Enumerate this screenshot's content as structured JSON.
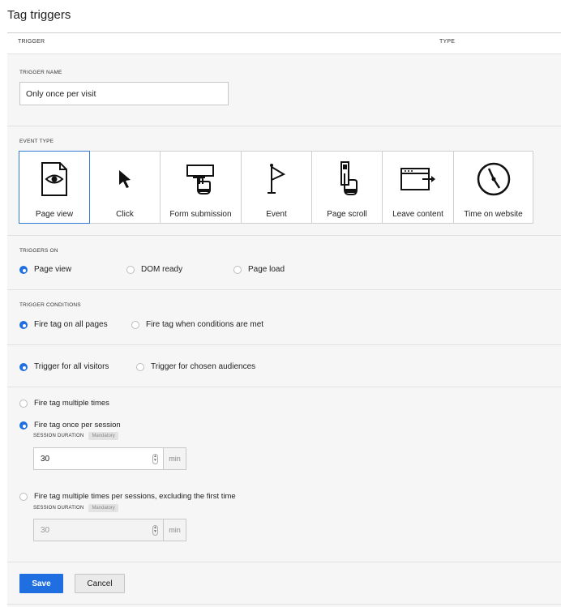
{
  "header": {
    "title": "Tag triggers",
    "col_trigger": "TRIGGER",
    "col_type": "TYPE"
  },
  "trigger_name": {
    "label": "TRIGGER NAME",
    "value": "Only once per visit"
  },
  "event_type": {
    "label": "EVENT TYPE",
    "selected": "Page view",
    "tiles": [
      {
        "label": "Page view",
        "icon": "page-view-icon"
      },
      {
        "label": "Click",
        "icon": "cursor-icon"
      },
      {
        "label": "Form submission",
        "icon": "form-submission-icon"
      },
      {
        "label": "Event",
        "icon": "flag-icon"
      },
      {
        "label": "Page scroll",
        "icon": "page-scroll-icon"
      },
      {
        "label": "Leave content",
        "icon": "leave-content-icon"
      },
      {
        "label": "Time on website",
        "icon": "clock-icon"
      }
    ]
  },
  "triggers_on": {
    "label": "TRIGGERS ON",
    "options": [
      "Page view",
      "DOM ready",
      "Page load"
    ],
    "selected": "Page view"
  },
  "trigger_conditions": {
    "label": "TRIGGER CONDITIONS",
    "options": [
      "Fire tag on all pages",
      "Fire tag when conditions are met"
    ],
    "selected": "Fire tag on all pages"
  },
  "audience": {
    "options": [
      "Trigger for all visitors",
      "Trigger for chosen audiences"
    ],
    "selected": "Trigger for all visitors"
  },
  "frequency": {
    "multiple": "Fire tag multiple times",
    "once_per_session": "Fire tag once per session",
    "multiple_excluding_first": "Fire tag multiple times per sessions, excluding the first time",
    "selected": "Fire tag once per session",
    "session_duration_label": "SESSION DURATION",
    "mandatory_badge": "Mandatory",
    "session_duration_value": "30",
    "session_duration_value_disabled": "30",
    "unit": "min"
  },
  "actions": {
    "save": "Save",
    "cancel": "Cancel"
  },
  "colors": {
    "accent": "#1f6fe0",
    "panel_bg": "#f6f6f6"
  }
}
